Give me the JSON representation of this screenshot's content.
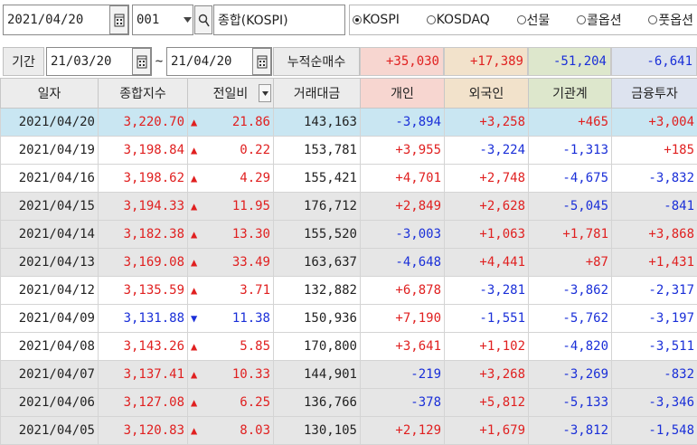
{
  "toolbar": {
    "date": "2021/04/20",
    "code": "001",
    "name": "종합(KOSPI)",
    "markets": [
      {
        "label": "KOSPI",
        "selected": true
      },
      {
        "label": "KOSDAQ",
        "selected": false
      },
      {
        "label": "선물",
        "selected": false
      },
      {
        "label": "콜옵션",
        "selected": false
      },
      {
        "label": "풋옵션",
        "selected": false
      }
    ]
  },
  "period": {
    "label": "기간",
    "from": "21/03/20",
    "tilde": "~",
    "to": "21/04/20",
    "cumulative_label": "누적순매수",
    "sums": [
      "+35,030",
      "+17,389",
      "-51,204",
      "-6,641"
    ]
  },
  "colors": {
    "header_bg": "#ececec",
    "individual_bg": "#f7d6d0",
    "foreign_bg": "#f2e2cb",
    "institution_bg": "#dde7cc",
    "finance_bg": "#dde3ef",
    "selected_row": "#c9e6f2",
    "gray_row": "#e6e6e6",
    "up": "#e02020",
    "down": "#1a2fd8"
  },
  "table": {
    "headers": [
      "일자",
      "종합지수",
      "전일비",
      "거래대금",
      "개인",
      "외국인",
      "기관계",
      "금융투자"
    ],
    "rows": [
      {
        "date": "2021/04/20",
        "index": "3,220.70",
        "dir": "up",
        "change": "21.86",
        "volume": "143,163",
        "individual": "-3,894",
        "foreign": "+3,258",
        "institution": "+465",
        "finance": "+3,004",
        "shade": "selected"
      },
      {
        "date": "2021/04/19",
        "index": "3,198.84",
        "dir": "up",
        "change": "0.22",
        "volume": "153,781",
        "individual": "+3,955",
        "foreign": "-3,224",
        "institution": "-1,313",
        "finance": "+185",
        "shade": "white"
      },
      {
        "date": "2021/04/16",
        "index": "3,198.62",
        "dir": "up",
        "change": "4.29",
        "volume": "155,421",
        "individual": "+4,701",
        "foreign": "+2,748",
        "institution": "-4,675",
        "finance": "-3,832",
        "shade": "white"
      },
      {
        "date": "2021/04/15",
        "index": "3,194.33",
        "dir": "up",
        "change": "11.95",
        "volume": "176,712",
        "individual": "+2,849",
        "foreign": "+2,628",
        "institution": "-5,045",
        "finance": "-841",
        "shade": "gray"
      },
      {
        "date": "2021/04/14",
        "index": "3,182.38",
        "dir": "up",
        "change": "13.30",
        "volume": "155,520",
        "individual": "-3,003",
        "foreign": "+1,063",
        "institution": "+1,781",
        "finance": "+3,868",
        "shade": "gray"
      },
      {
        "date": "2021/04/13",
        "index": "3,169.08",
        "dir": "up",
        "change": "33.49",
        "volume": "163,637",
        "individual": "-4,648",
        "foreign": "+4,441",
        "institution": "+87",
        "finance": "+1,431",
        "shade": "gray"
      },
      {
        "date": "2021/04/12",
        "index": "3,135.59",
        "dir": "up",
        "change": "3.71",
        "volume": "132,882",
        "individual": "+6,878",
        "foreign": "-3,281",
        "institution": "-3,862",
        "finance": "-2,317",
        "shade": "white"
      },
      {
        "date": "2021/04/09",
        "index": "3,131.88",
        "dir": "down",
        "change": "11.38",
        "volume": "150,936",
        "individual": "+7,190",
        "foreign": "-1,551",
        "institution": "-5,762",
        "finance": "-3,197",
        "shade": "white"
      },
      {
        "date": "2021/04/08",
        "index": "3,143.26",
        "dir": "up",
        "change": "5.85",
        "volume": "170,800",
        "individual": "+3,641",
        "foreign": "+1,102",
        "institution": "-4,820",
        "finance": "-3,511",
        "shade": "white"
      },
      {
        "date": "2021/04/07",
        "index": "3,137.41",
        "dir": "up",
        "change": "10.33",
        "volume": "144,901",
        "individual": "-219",
        "foreign": "+3,268",
        "institution": "-3,269",
        "finance": "-832",
        "shade": "gray"
      },
      {
        "date": "2021/04/06",
        "index": "3,127.08",
        "dir": "up",
        "change": "6.25",
        "volume": "136,766",
        "individual": "-378",
        "foreign": "+5,812",
        "institution": "-5,133",
        "finance": "-3,346",
        "shade": "gray"
      },
      {
        "date": "2021/04/05",
        "index": "3,120.83",
        "dir": "up",
        "change": "8.03",
        "volume": "130,105",
        "individual": "+2,129",
        "foreign": "+1,679",
        "institution": "-3,812",
        "finance": "-1,548",
        "shade": "gray"
      }
    ]
  }
}
